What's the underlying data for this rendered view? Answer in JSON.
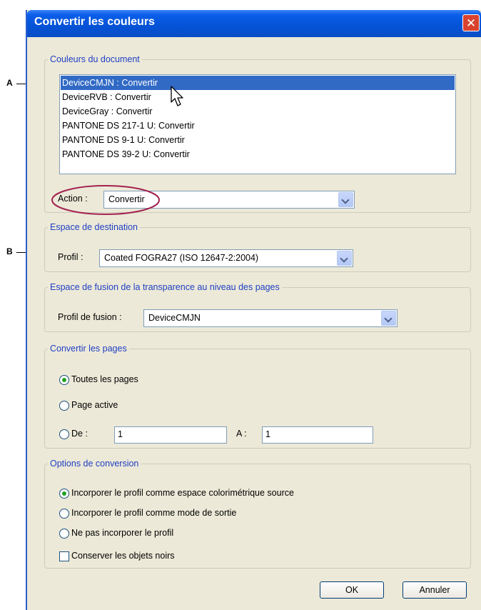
{
  "callouts": {
    "a": "A",
    "b": "B"
  },
  "window": {
    "title": "Convertir les couleurs",
    "close_icon": "close-icon",
    "close_glyph": "✕"
  },
  "document_colors": {
    "legend": "Couleurs du document",
    "items": [
      "DeviceCMJN : Convertir",
      "DeviceRVB : Convertir",
      "DeviceGray : Convertir",
      "PANTONE DS 217-1 U: Convertir",
      "PANTONE DS 9-1 U: Convertir",
      "PANTONE DS 39-2 U: Convertir"
    ],
    "selected_index": 0,
    "action_label": "Action :",
    "action_value": "Convertir",
    "highlight_color": "#a3224f"
  },
  "destination": {
    "legend": "Espace de destination",
    "profile_label": "Profil :",
    "profile_value": "Coated FOGRA27 (ISO 12647-2:2004)"
  },
  "blending": {
    "legend": "Espace de fusion de la transparence au niveau des pages",
    "label": "Profil de fusion :",
    "value": "DeviceCMJN"
  },
  "pages": {
    "legend": "Convertir les pages",
    "all_label": "Toutes les pages",
    "active_label": "Page active",
    "from_label": "De :",
    "from_value": "1",
    "to_label": "A :",
    "to_value": "1",
    "selected": "all"
  },
  "options": {
    "legend": "Options de conversion",
    "embed_source_label": "Incorporer le profil comme espace colorimétrique source",
    "embed_output_label": "Incorporer le profil comme mode de sortie",
    "no_embed_label": "Ne pas incorporer le profil",
    "preserve_black_label": "Conserver les objets noirs",
    "preserve_black_checked": false,
    "selected": "embed_source"
  },
  "buttons": {
    "ok": "OK",
    "cancel": "Annuler"
  },
  "colors": {
    "selection": "#316ac5",
    "legend_text": "#1f3fc4",
    "title_bar": "#0a5ee9"
  }
}
